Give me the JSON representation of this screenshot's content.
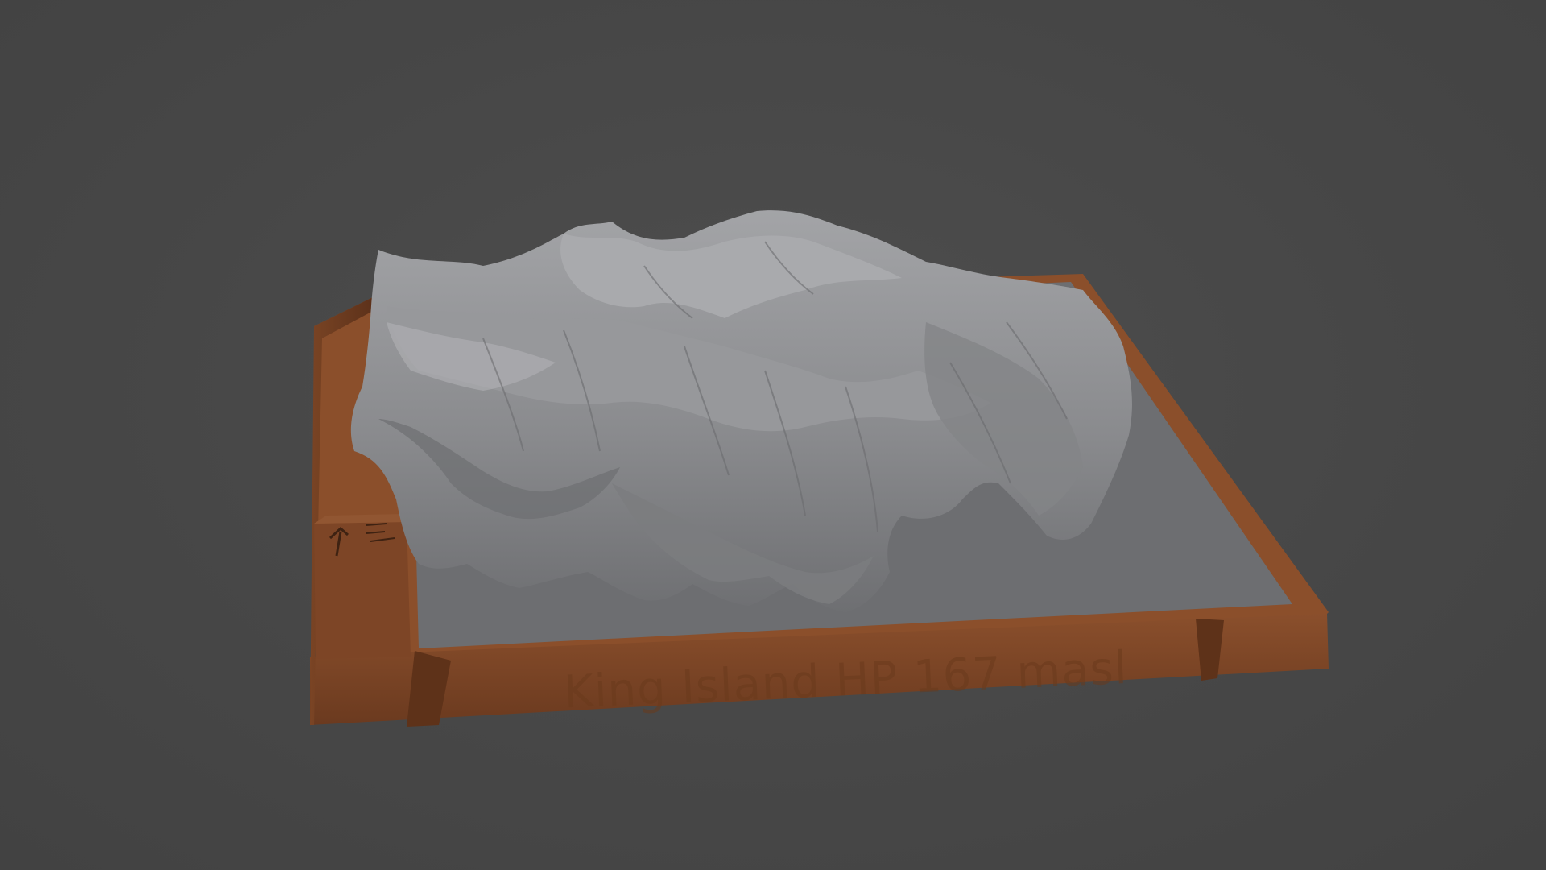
{
  "scene": {
    "subject": "3D terrain relief model on wooden base",
    "background_color": "#484848",
    "terrain_color": "#8f9093",
    "base_color": "#7a4526",
    "plateau_color": "#6b6c6f"
  },
  "plaque": {
    "text": "King Island HP 167 masl"
  },
  "corner_block": {
    "icon": "north-arrow-icon",
    "scale_icon": "scale-bar-icon"
  }
}
